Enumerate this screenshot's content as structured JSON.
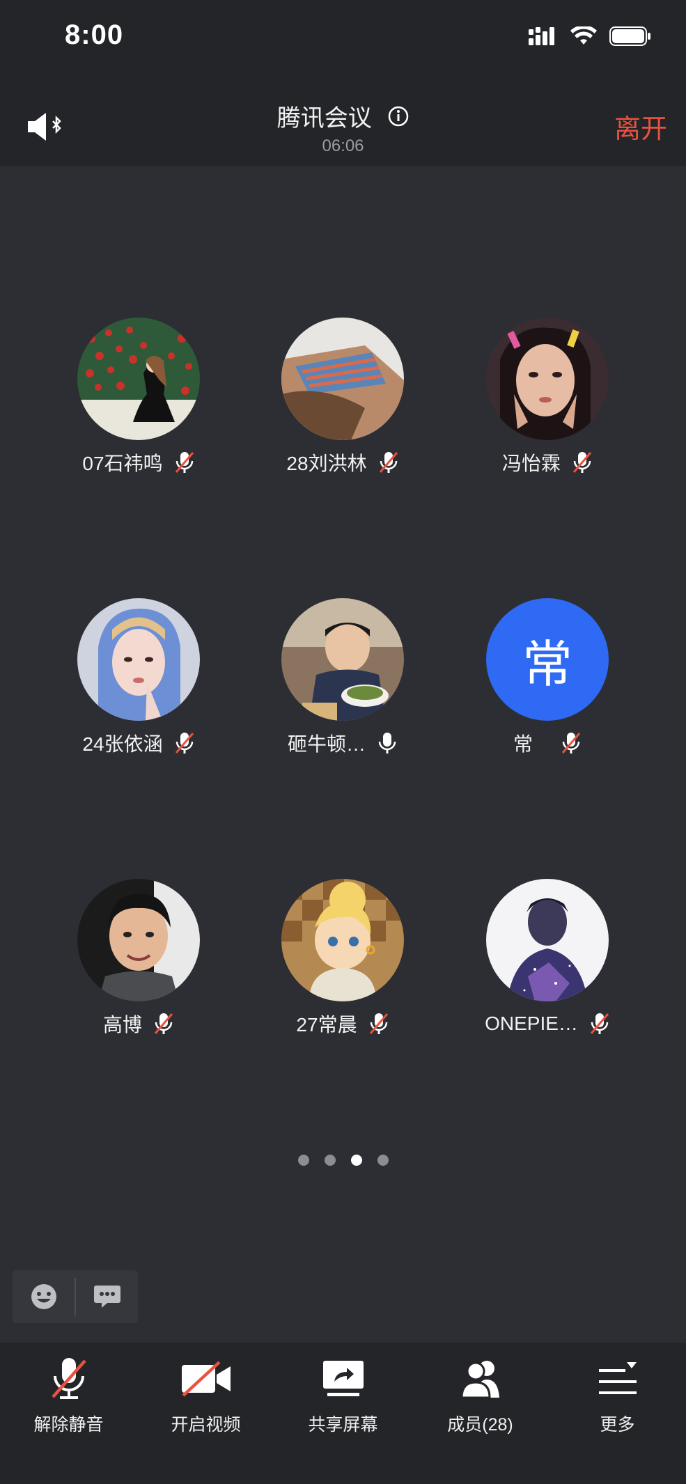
{
  "status_bar": {
    "time": "8:00"
  },
  "header": {
    "title": "腾讯会议",
    "elapsed": "06:06",
    "leave_label": "离开"
  },
  "participants": [
    {
      "name": "07石祎鸣",
      "mic": "muted",
      "avatar": "rose-illustration"
    },
    {
      "name": "28刘洪林",
      "mic": "muted",
      "avatar": "photo"
    },
    {
      "name": "冯怡霖",
      "mic": "muted",
      "avatar": "photo"
    },
    {
      "name": "24张依涵",
      "mic": "muted",
      "avatar": "photo"
    },
    {
      "name": "砸牛顿…",
      "mic": "on",
      "avatar": "photo"
    },
    {
      "name": "常",
      "mic": "muted",
      "avatar": "initial",
      "initial": "常",
      "avatar_color": "#2f6af5"
    },
    {
      "name": "高博",
      "mic": "muted",
      "avatar": "photo"
    },
    {
      "name": "27常晨",
      "mic": "muted",
      "avatar": "cartoon"
    },
    {
      "name": "ONEPIE…",
      "mic": "muted",
      "avatar": "galaxy-photo"
    }
  ],
  "pagination": {
    "pages": 4,
    "current": 3
  },
  "chat": {
    "emoji_icon": "smile-icon",
    "message_icon": "chat-bubble-icon"
  },
  "toolbar": {
    "unmute_label": "解除静音",
    "video_label": "开启视频",
    "share_label": "共享屏幕",
    "members_label": "成员(28)",
    "more_label": "更多"
  },
  "colors": {
    "accent_red": "#e8523f",
    "initial_blue": "#2f6af5",
    "background": "#2c2e33",
    "bars": "#242528"
  }
}
